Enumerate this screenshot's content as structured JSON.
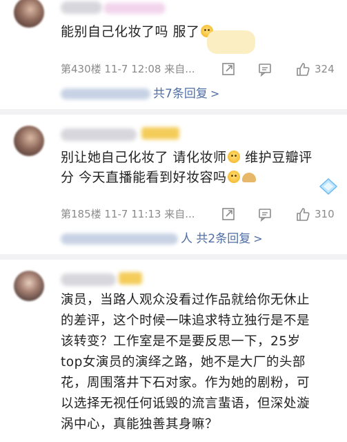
{
  "comments": [
    {
      "text": "能别自己化妆了吗 服了",
      "floor": "第430楼",
      "time": "11-7 12:08",
      "source": "来自...",
      "likes": "324",
      "reply_suffix": "共7条回复"
    },
    {
      "text_line1": "别让她自己化妆了 请化妆师",
      "text_line1b": " 维护豆瓣评",
      "text_line2": "分 今天直播能看到好妆容吗",
      "floor": "第185楼",
      "time": "11-7 11:13",
      "source": "来自...",
      "likes": "310",
      "reply_suffix": "人 共2条回复"
    },
    {
      "lines": [
        "演员，当路人观众没看过作品就给你无休止",
        "的差评，这个时候一味追求特立独行是不是",
        "该转变？工作室是不是要反思一下，25岁",
        "top女演员的演绎之路，她不是大厂的头部",
        "花，周围落井下石对家。作为她的剧粉，可",
        "以选择无视任何诋毁的流言蜚语，但深处漩",
        "涡中心，真能独善其身嘛？"
      ]
    }
  ],
  "icons": [
    "share-icon",
    "comment-icon",
    "like-icon"
  ],
  "colors": {
    "reply_link": "#4e6ea5",
    "meta": "#8a8a8a",
    "divider": "#f2f2f4"
  }
}
